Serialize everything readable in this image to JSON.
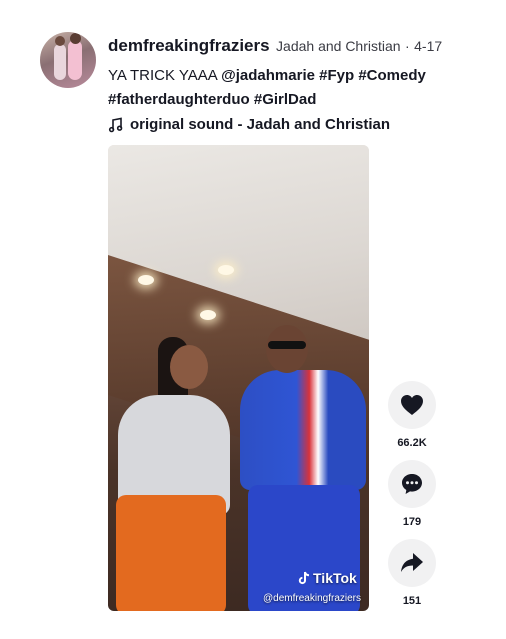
{
  "author": {
    "username": "demfreakingfraziers",
    "nickname": "Jadah and Christian",
    "separator": "·",
    "date": "4-17"
  },
  "caption": {
    "text": "YA TRICK YAAA",
    "tags": [
      "@jadahmarie",
      "#Fyp",
      "#Comedy",
      "#fatherdaughterduo",
      "#GirlDad"
    ]
  },
  "sound": {
    "icon": "music-note-icon",
    "label": "original sound - Jadah and Christian"
  },
  "video": {
    "watermark_logo": "TikTok",
    "watermark_handle": "@demfreakingfraziers"
  },
  "actions": {
    "like": {
      "icon": "heart-icon",
      "count": "66.2K"
    },
    "comment": {
      "icon": "comment-icon",
      "count": "179"
    },
    "share": {
      "icon": "share-icon",
      "count": "151"
    }
  }
}
